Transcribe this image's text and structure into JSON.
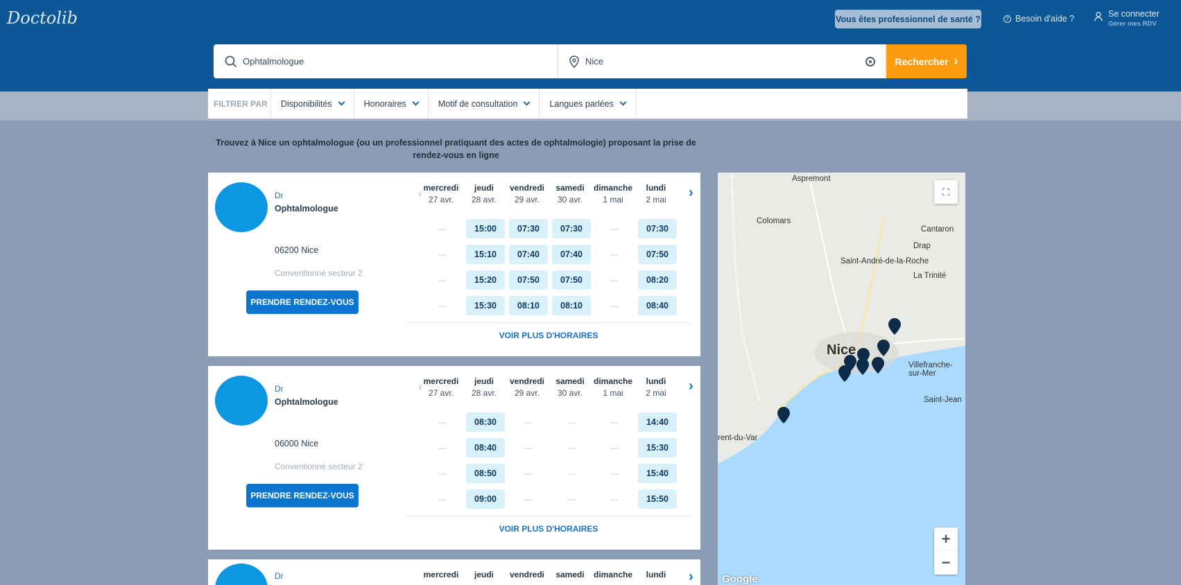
{
  "header": {
    "logo": "Doctolib",
    "pro_button": "Vous êtes professionnel de santé ?",
    "help": "Besoin d'aide ?",
    "login": "Se connecter",
    "login_sub": "Gérer mes RDV"
  },
  "search": {
    "specialty": "Ophtalmologue",
    "location": "Nice",
    "button": "Rechercher"
  },
  "filters": {
    "label": "FILTRER PAR",
    "items": [
      "Disponibilités",
      "Honoraires",
      "Motif de consultation",
      "Langues parlées"
    ]
  },
  "intro": "Trouvez à Nice un ophtalmologue (ou un professionnel pratiquant des actes de ophtalmologie) proposant la prise de rendez-vous en ligne",
  "days": [
    {
      "name": "mercredi",
      "date": "27 avr."
    },
    {
      "name": "jeudi",
      "date": "28 avr."
    },
    {
      "name": "vendredi",
      "date": "29 avr."
    },
    {
      "name": "samedi",
      "date": "30 avr."
    },
    {
      "name": "dimanche",
      "date": "1 mai"
    },
    {
      "name": "lundi",
      "date": "2 mai"
    }
  ],
  "results": [
    {
      "title": "Dr",
      "specialty": "Ophtalmologue",
      "address": "06200 Nice",
      "convention": "Conventionné secteur 2",
      "button": "PRENDRE RENDEZ-VOUS",
      "more": "VOIR PLUS D'HORAIRES",
      "slots": [
        [
          "—",
          "15:00",
          "07:30",
          "07:30",
          "—",
          "07:30"
        ],
        [
          "—",
          "15:10",
          "07:40",
          "07:40",
          "—",
          "07:50"
        ],
        [
          "—",
          "15:20",
          "07:50",
          "07:50",
          "—",
          "08:20"
        ],
        [
          "—",
          "15:30",
          "08:10",
          "08:10",
          "—",
          "08:40"
        ]
      ]
    },
    {
      "title": "Dr",
      "specialty": "Ophtalmologue",
      "address": "06000 Nice",
      "convention": "Conventionné secteur 2",
      "button": "PRENDRE RENDEZ-VOUS",
      "more": "VOIR PLUS D'HORAIRES",
      "slots": [
        [
          "—",
          "08:30",
          "—",
          "—",
          "—",
          "14:40"
        ],
        [
          "—",
          "08:40",
          "—",
          "—",
          "—",
          "15:30"
        ],
        [
          "—",
          "08:50",
          "—",
          "—",
          "—",
          "15:40"
        ],
        [
          "—",
          "09:00",
          "—",
          "—",
          "—",
          "15:50"
        ]
      ]
    },
    {
      "title": "Dr"
    }
  ],
  "map": {
    "places": [
      "Aspremont",
      "Colomars",
      "Cantaron",
      "Drap",
      "Saint-André-de-la-Roche",
      "La Trinité",
      "Nice",
      "Villefranche-sur-Mer",
      "Saint-Jean",
      "rent-du-Var"
    ],
    "attribution": "Google",
    "zoom_in": "+",
    "zoom_out": "−"
  }
}
